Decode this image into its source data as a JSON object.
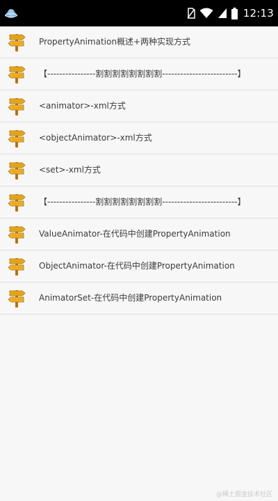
{
  "status_bar": {
    "time": "12:13",
    "icons": [
      "android-app-icon",
      "no-sim-icon",
      "wifi-icon",
      "cellular-signal-icon",
      "battery-icon"
    ]
  },
  "list": {
    "item_icon": "wooden-signpost-icon",
    "items": [
      {
        "label": "PropertyAnimation概述+两种实现方式"
      },
      {
        "label": "【----------------割割割割割割割割-------------------------】"
      },
      {
        "label": "<animator>-xml方式"
      },
      {
        "label": "<objectAnimator>-xml方式"
      },
      {
        "label": "<set>-xml方式"
      },
      {
        "label": "【----------------割割割割割割割割-------------------------】"
      },
      {
        "label": "ValueAnimator-在代码中创建PropertyAnimation"
      },
      {
        "label": "ObjectAnimator-在代码中创建PropertyAnimation"
      },
      {
        "label": "AnimatorSet-在代码中创建PropertyAnimation"
      }
    ]
  },
  "watermark": "@稀土掘金技术社区",
  "colors": {
    "status_bar_bg": "#000000",
    "list_bg": "#f7f7f7",
    "divider": "#dedede",
    "text": "#3b3b3b",
    "sign_wood": "#e9a81c",
    "sign_post": "#b37512"
  }
}
